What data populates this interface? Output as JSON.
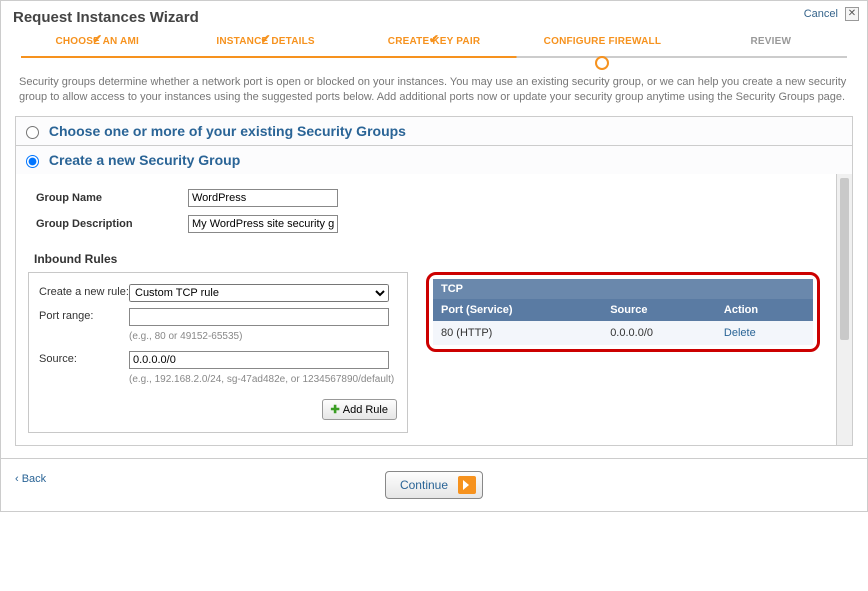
{
  "header": {
    "title": "Request Instances Wizard",
    "cancel": "Cancel"
  },
  "steps": [
    {
      "label": "CHOOSE AN AMI",
      "state": "done"
    },
    {
      "label": "INSTANCE DETAILS",
      "state": "done"
    },
    {
      "label": "CREATE KEY PAIR",
      "state": "done"
    },
    {
      "label": "CONFIGURE FIREWALL",
      "state": "current"
    },
    {
      "label": "REVIEW",
      "state": "pending"
    }
  ],
  "description": "Security groups determine whether a network port is open or blocked on your instances. You may use an existing security group, or we can help you create a new security group to allow access to your instances using the suggested ports below. Add additional ports now or update your security group anytime using the Security Groups page.",
  "radio": {
    "existing": "Choose one or more of your existing Security Groups",
    "create": "Create a new Security Group"
  },
  "form": {
    "group_name_label": "Group Name",
    "group_name_value": "WordPress",
    "group_desc_label": "Group Description",
    "group_desc_value": "My WordPress site security group",
    "inbound_rules_label": "Inbound Rules",
    "create_rule_label": "Create a new rule:",
    "rule_type_value": "Custom TCP rule",
    "port_range_label": "Port range:",
    "port_range_value": "",
    "port_range_hint": "(e.g., 80 or 49152-65535)",
    "source_label": "Source:",
    "source_value": "0.0.0.0/0",
    "source_hint": "(e.g., 192.168.2.0/24, sg-47ad482e, or 1234567890/default)",
    "add_rule_label": "Add Rule"
  },
  "rules_table": {
    "protocol": "TCP",
    "headers": {
      "port": "Port (Service)",
      "source": "Source",
      "action": "Action"
    },
    "rows": [
      {
        "port": "80 (HTTP)",
        "source": "0.0.0.0/0",
        "action": "Delete"
      }
    ]
  },
  "footer": {
    "back": "‹ Back",
    "continue": "Continue"
  }
}
